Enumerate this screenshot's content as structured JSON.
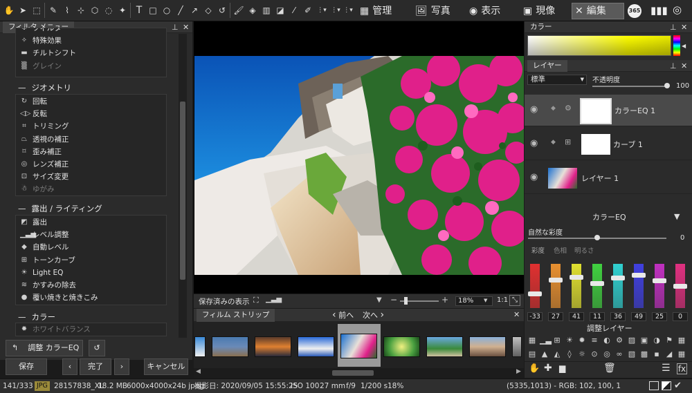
{
  "toolbar": {
    "modes": [
      {
        "label": "管理",
        "icon": "grid-icon"
      },
      {
        "label": "写真",
        "icon": "photo-icon"
      },
      {
        "label": "表示",
        "icon": "eye-icon"
      },
      {
        "label": "現像",
        "icon": "develop-icon"
      },
      {
        "label": "編集",
        "icon": "edit-tools-icon"
      }
    ],
    "active_mode": "編集",
    "badge_365": "365"
  },
  "filter_panel": {
    "title": "フィルタ メニュー",
    "groups": [
      {
        "name": "",
        "items": [
          {
            "label": "フィルタ",
            "icon": "filter-icon",
            "disabled": false
          },
          {
            "label": "特殊効果",
            "icon": "magic-wand-icon",
            "disabled": false
          },
          {
            "label": "チルトシフト",
            "icon": "tilt-shift-icon",
            "disabled": false
          },
          {
            "label": "グレイン",
            "icon": "grain-icon",
            "disabled": true
          }
        ]
      },
      {
        "name": "ジオメトリ",
        "items": [
          {
            "label": "回転",
            "icon": "rotate-icon",
            "disabled": false
          },
          {
            "label": "反転",
            "icon": "flip-icon",
            "disabled": false
          },
          {
            "label": "トリミング",
            "icon": "crop-icon",
            "disabled": false
          },
          {
            "label": "透視の補正",
            "icon": "perspective-icon",
            "disabled": false
          },
          {
            "label": "歪み補正",
            "icon": "distortion-icon",
            "disabled": false
          },
          {
            "label": "レンズ補正",
            "icon": "lens-icon",
            "disabled": false
          },
          {
            "label": "サイズ変更",
            "icon": "resize-icon",
            "disabled": false
          },
          {
            "label": "ゆがみ",
            "icon": "liquify-icon",
            "disabled": true
          }
        ]
      },
      {
        "name": "露出 / ライティング",
        "items": [
          {
            "label": "露出",
            "icon": "exposure-icon",
            "disabled": false
          },
          {
            "label": "レベル調整",
            "icon": "levels-icon",
            "disabled": false
          },
          {
            "label": "自動レベル",
            "icon": "auto-level-icon",
            "disabled": false
          },
          {
            "label": "トーンカーブ",
            "icon": "tone-curve-icon",
            "disabled": false
          },
          {
            "label": "Light EQ",
            "icon": "light-eq-icon",
            "disabled": false
          },
          {
            "label": "かすみの除去",
            "icon": "dehaze-icon",
            "disabled": false
          },
          {
            "label": "覆い焼きと焼きこみ",
            "icon": "dodge-burn-icon",
            "disabled": false
          }
        ]
      },
      {
        "name": "カラー",
        "items": [
          {
            "label": "ホワイトバランス",
            "icon": "white-balance-icon",
            "disabled": true
          }
        ]
      }
    ],
    "adjust_button": "調整 カラーEQ",
    "save_button": "保存",
    "done_button": "完了",
    "cancel_button": "キャンセル"
  },
  "viewer": {
    "saved_view_label": "保存済みの表示",
    "zoom": "18%",
    "ratio": "1:1"
  },
  "filmstrip": {
    "title": "フィルム ストリップ",
    "prev": "前へ",
    "next": "次へ",
    "selected_index": 3
  },
  "color_panel": {
    "title": "カラー"
  },
  "layers_panel": {
    "title": "レイヤー",
    "blend_mode": "標準",
    "opacity_label": "不透明度",
    "opacity": "100",
    "layers": [
      {
        "name": "カラーEQ 1",
        "selected": true
      },
      {
        "name": "カーブ 1",
        "selected": false
      },
      {
        "name": "レイヤー 1",
        "selected": false
      }
    ]
  },
  "color_eq": {
    "title": "カラーEQ",
    "vibrance_label": "自然な彩度",
    "vibrance_value": "0",
    "tabs": [
      "彩度",
      "色相",
      "明るさ"
    ],
    "sliders": [
      {
        "value": -33,
        "color": "#e03030"
      },
      {
        "value": 27,
        "color": "#e89030"
      },
      {
        "value": 41,
        "color": "#e0e030"
      },
      {
        "value": 11,
        "color": "#40d040"
      },
      {
        "value": 36,
        "color": "#30d0d0"
      },
      {
        "value": 49,
        "color": "#4040e0"
      },
      {
        "value": 25,
        "color": "#c030c0"
      },
      {
        "value": 0,
        "color": "#e03080"
      }
    ],
    "adjust_layers_label": "調整レイヤー"
  },
  "status_bar": {
    "index": "141/333",
    "format": "JPG",
    "filename": "28157838_XL",
    "filesize": "18.2 MB",
    "dimensions": "6000x4000x24b jpeg",
    "date": "撮影日: 2020/09/05 15:55:25",
    "iso": "ISO 100",
    "focal": "27 mm",
    "aperture": "f/9",
    "shutter": "1/200 s",
    "zoom": "18%",
    "pixel_info": "(5335,1013) - RGB: 102, 100, 1"
  }
}
